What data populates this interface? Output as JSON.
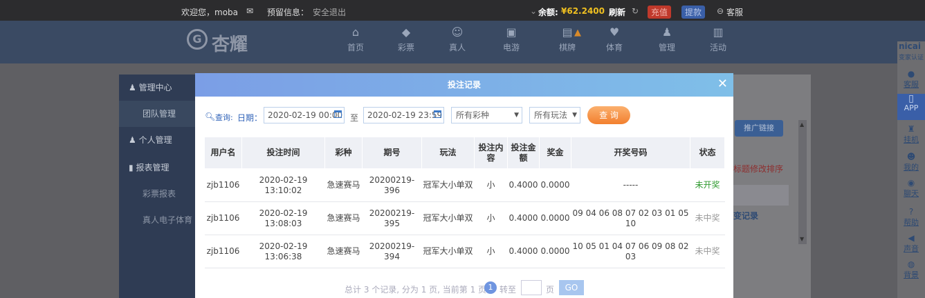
{
  "topbar": {
    "welcome": "欢迎您，moba",
    "reserve_info": "预留信息：",
    "logout": "安全退出",
    "balance_label": "余额:",
    "balance_value": "¥62.2400",
    "refresh": "刷新",
    "deposit": "充值",
    "withdraw": "提款",
    "service": "客服"
  },
  "logo": {
    "text": "杏耀"
  },
  "nav": [
    {
      "label": "首页",
      "icon": "home-icon",
      "glyph": "⌂"
    },
    {
      "label": "彩票",
      "icon": "diamond-icon",
      "glyph": "◆"
    },
    {
      "label": "真人",
      "icon": "person-icon",
      "glyph": "☺"
    },
    {
      "label": "电游",
      "icon": "slot-icon",
      "glyph": "▣"
    },
    {
      "label": "棋牌",
      "icon": "cards-icon",
      "glyph": "▤"
    },
    {
      "label": "体育",
      "icon": "trophy-icon",
      "glyph": "♥"
    },
    {
      "label": "管理",
      "icon": "users-icon",
      "glyph": "♟"
    },
    {
      "label": "活动",
      "icon": "gift-icon",
      "glyph": "▥"
    }
  ],
  "sidemenu": {
    "mgmt_center": "管理中心",
    "team_mgmt": "团队管理",
    "personal_mgmt": "个人管理",
    "report_mgmt": "报表管理",
    "lottery_report": "彩票报表",
    "live_sports": "真人电子体育"
  },
  "background": {
    "promo_link": "推广链接",
    "sort_hint": "标题修改排序",
    "change_record": "变记录"
  },
  "rightbar": [
    {
      "label": "客服",
      "icon": "eye-icon",
      "glyph": "●"
    },
    {
      "label": "APP",
      "icon": "phone-icon",
      "glyph": "▯"
    },
    {
      "label": "挂机",
      "icon": "robot-icon",
      "glyph": "♜"
    },
    {
      "label": "我的",
      "icon": "user-icon",
      "glyph": "☻"
    },
    {
      "label": "聊天",
      "icon": "chat-icon",
      "glyph": "◉"
    },
    {
      "label": "帮助",
      "icon": "help-icon",
      "glyph": "?"
    },
    {
      "label": "声音",
      "icon": "sound-icon",
      "glyph": "◀"
    },
    {
      "label": "背景",
      "icon": "palette-icon",
      "glyph": "◍"
    }
  ],
  "rightbar_brand": "nicai",
  "rightbar_brand_sub": "变家认证",
  "modal": {
    "title": "投注记录",
    "filter": {
      "query_label": "查询:",
      "date_label": "日期：",
      "start_date": "2020-02-19 00:00",
      "to_label": "至",
      "end_date": "2020-02-19 23:59",
      "lottery_select": "所有彩种",
      "play_select": "所有玩法",
      "query_button": "查 询"
    },
    "columns": [
      "用户名",
      "投注时间",
      "彩种",
      "期号",
      "玩法",
      "投注内容",
      "投注金额",
      "奖金",
      "开奖号码",
      "状态"
    ],
    "rows": [
      {
        "user": "zjb1106",
        "time": "2020-02-19 13:10:02",
        "lottery": "急速赛马",
        "issue": "20200219-396",
        "play": "冠军大小单双",
        "content": "小",
        "amount": "0.4000",
        "prize": "0.0000",
        "numbers": "-----",
        "status": "未开奖",
        "status_type": "pending"
      },
      {
        "user": "zjb1106",
        "time": "2020-02-19 13:08:03",
        "lottery": "急速赛马",
        "issue": "20200219-395",
        "play": "冠军大小单双",
        "content": "小",
        "amount": "0.4000",
        "prize": "0.0000",
        "numbers": "09 04 06 08 07 02 03 01 05 10",
        "status": "未中奖",
        "status_type": "lose"
      },
      {
        "user": "zjb1106",
        "time": "2020-02-19 13:06:38",
        "lottery": "急速赛马",
        "issue": "20200219-394",
        "play": "冠军大小单双",
        "content": "小",
        "amount": "0.4000",
        "prize": "0.0000",
        "numbers": "10 05 01 04 07 06 09 08 02 03",
        "status": "未中奖",
        "status_type": "lose"
      }
    ],
    "pager": {
      "summary": "总计 3 个记录, 分为 1 页, 当前第 1 页",
      "current": "1",
      "goto_label": "转至",
      "page_label": "页",
      "go_button": "GO"
    }
  },
  "colors": {
    "modal_header_start": "#7b9ee6",
    "modal_header_end": "#7fbfe8",
    "query_button": "#f27f2e",
    "pending_status": "#2f9a2f",
    "balance": "#f0c020",
    "deposit_bg": "#c0392b",
    "withdraw_bg": "#3a5fa8"
  }
}
